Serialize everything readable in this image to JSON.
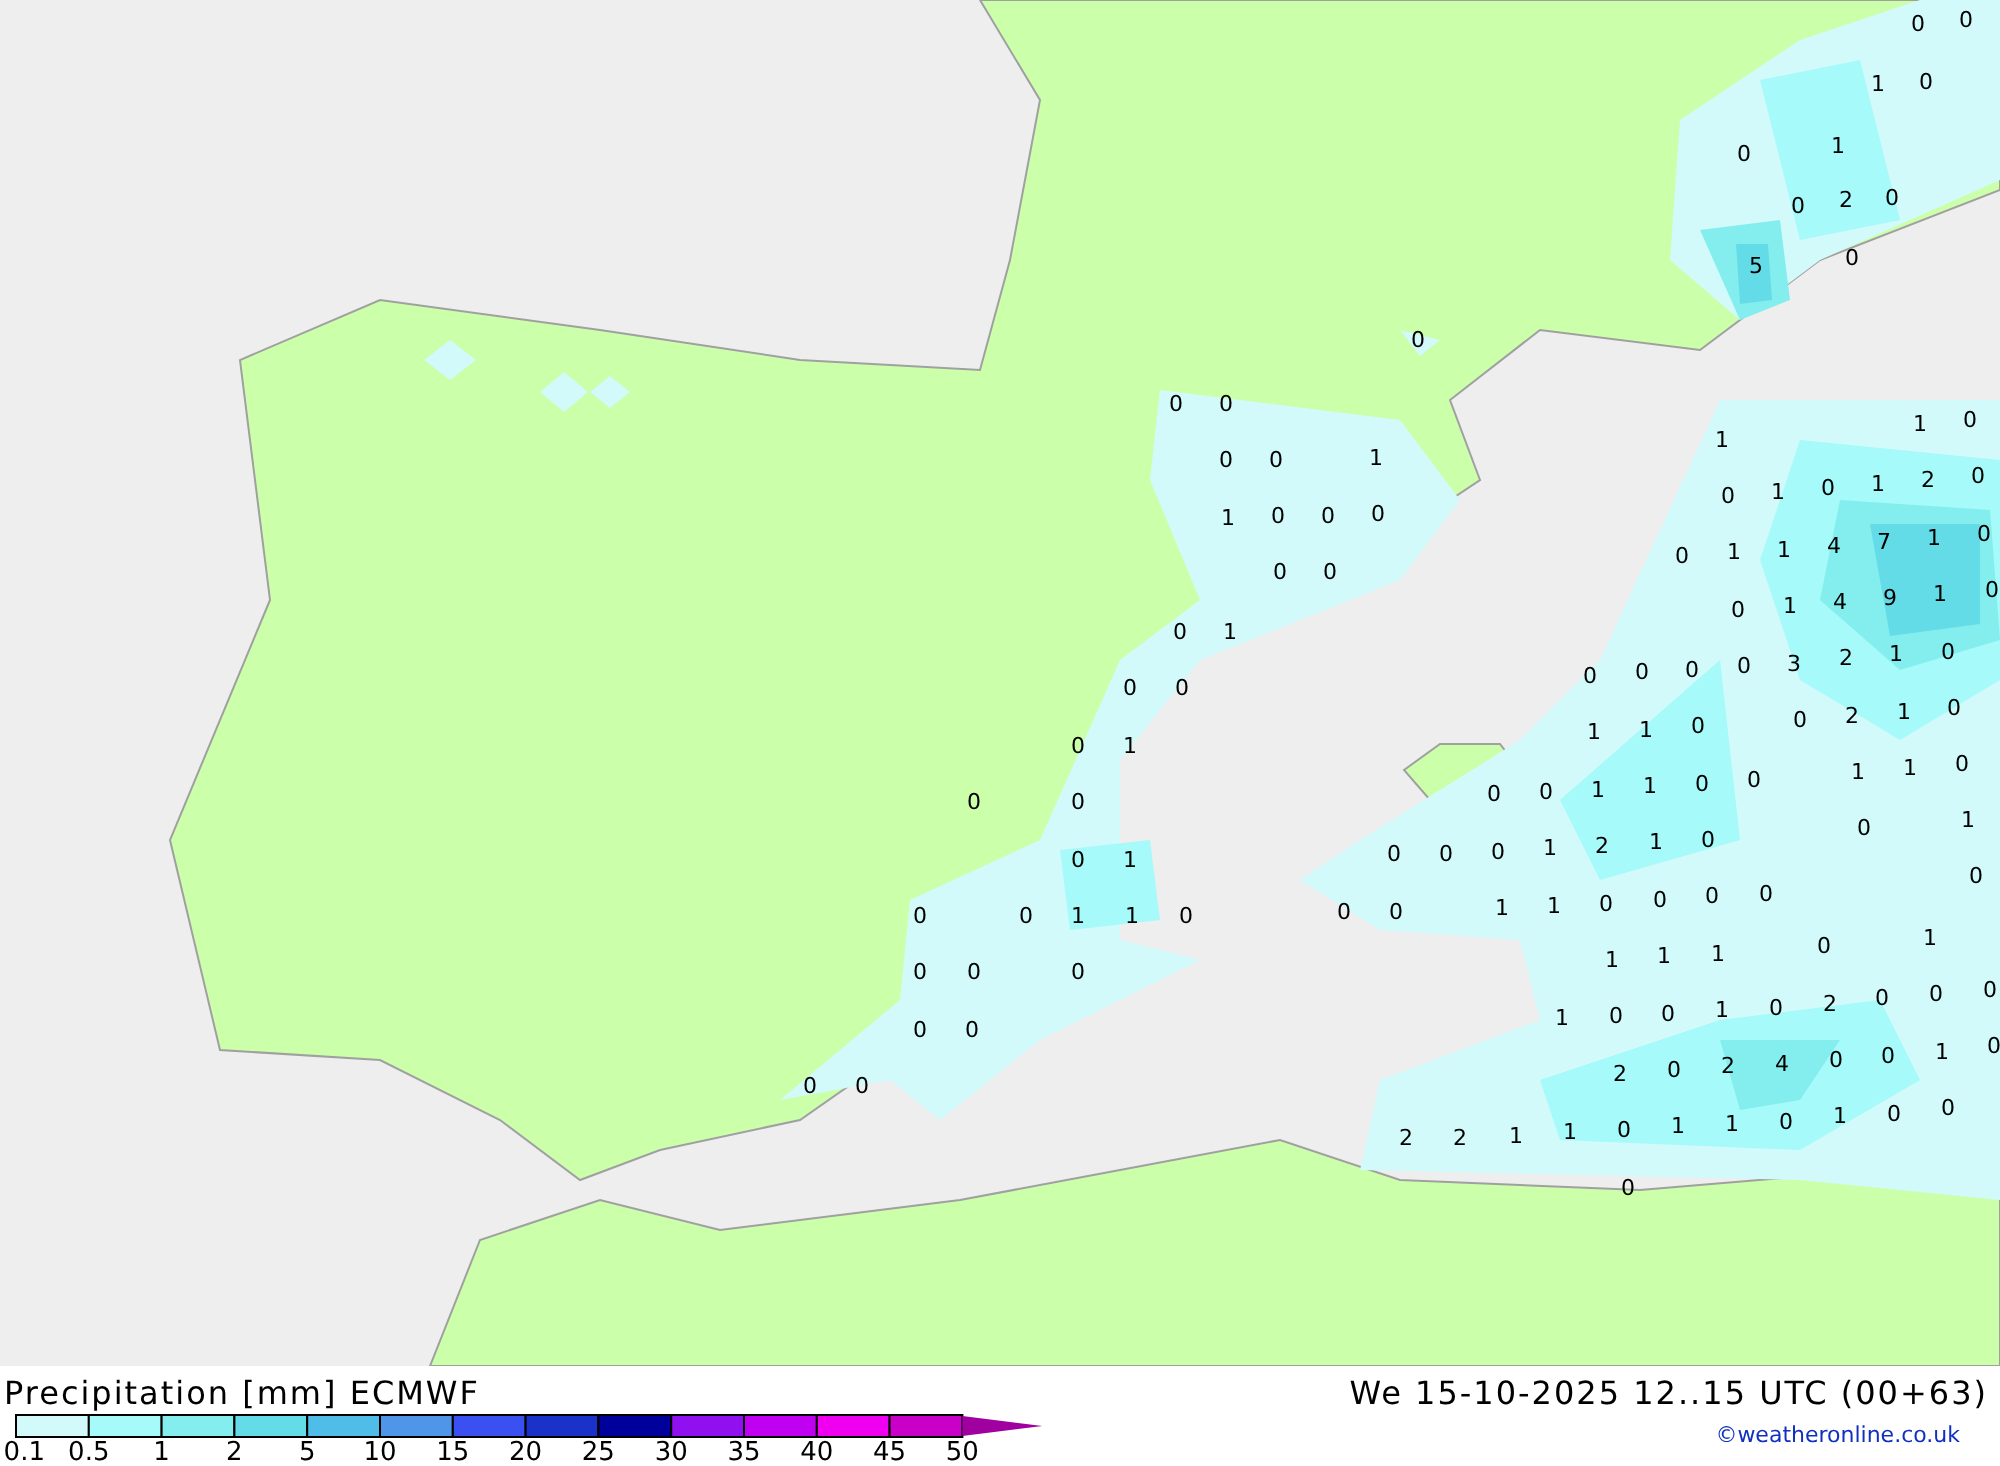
{
  "map": {
    "labels": [
      "0",
      "0",
      "1",
      "0",
      "0",
      "1",
      "0",
      "2",
      "0",
      "5",
      "0",
      "0",
      "0",
      "0",
      "0",
      "0",
      "1",
      "1",
      "0",
      "0",
      "0",
      "0",
      "0",
      "0",
      "1",
      "0",
      "0",
      "0",
      "1",
      "0",
      "0",
      "0",
      "1",
      "0",
      "0",
      "1",
      "1",
      "0",
      "0",
      "0",
      "0",
      "0",
      "0",
      "0",
      "0",
      "0",
      "0",
      "0",
      "1",
      "1",
      "0",
      "0",
      "1",
      "0",
      "1",
      "2",
      "0",
      "0",
      "1",
      "1",
      "4",
      "7",
      "1",
      "0",
      "0",
      "1",
      "4",
      "9",
      "1",
      "0",
      "0",
      "0",
      "0",
      "0",
      "3",
      "2",
      "1",
      "0",
      "1",
      "1",
      "0",
      "0",
      "2",
      "1",
      "0",
      "0",
      "0",
      "1",
      "1",
      "0",
      "0",
      "1",
      "1",
      "0",
      "0",
      "0",
      "1",
      "2",
      "1",
      "0",
      "0",
      "1",
      "1",
      "1",
      "0",
      "0",
      "0",
      "0",
      "0",
      "1",
      "1",
      "1",
      "1",
      "0",
      "1",
      "0",
      "0",
      "1",
      "0",
      "2",
      "0",
      "0",
      "0",
      "2",
      "0",
      "2",
      "4",
      "0",
      "0",
      "1",
      "0",
      "2",
      "2",
      "1",
      "1",
      "0",
      "1",
      "1",
      "0",
      "1",
      "0",
      "0",
      "0"
    ]
  },
  "legend": {
    "title": "Precipitation [mm] ECMWF",
    "swatches": [
      {
        "color": "#d2fafa"
      },
      {
        "color": "#a6fafa"
      },
      {
        "color": "#84eeee"
      },
      {
        "color": "#64dce8"
      },
      {
        "color": "#50bce8"
      },
      {
        "color": "#5096e8"
      },
      {
        "color": "#3a50f0"
      },
      {
        "color": "#1a32c8"
      },
      {
        "color": "#00009a"
      },
      {
        "color": "#9010f0"
      },
      {
        "color": "#c000f0"
      },
      {
        "color": "#f000f0"
      },
      {
        "color": "#c800c8"
      }
    ],
    "ticks": [
      "0.1",
      "0.5",
      "1",
      "2",
      "5",
      "10",
      "15",
      "20",
      "25",
      "30",
      "35",
      "40",
      "45",
      "50"
    ]
  },
  "valid_time": "We 15-10-2025 12..15 UTC (00+63)",
  "credit": "©weatheronline.co.uk"
}
